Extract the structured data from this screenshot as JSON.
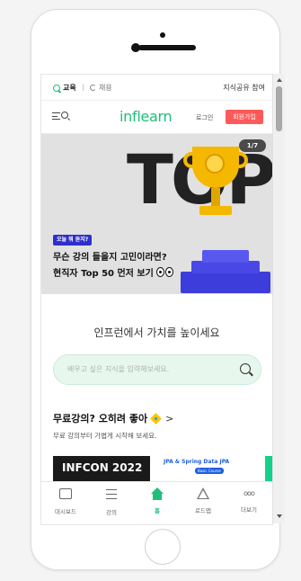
{
  "topbar": {
    "edu_label": "교육",
    "job_label": "채용",
    "share_label": "지식공유 참여"
  },
  "header": {
    "logo": "inflearn",
    "login_label": "로그인",
    "signup_label": "회원가입"
  },
  "banner": {
    "top_text": "TOP",
    "pager": "1/7",
    "badge": "오늘 뭐 듣지?",
    "title_line1": "무슨 강의 들을지 고민이라면?",
    "title_line2": "현직자 Top 50 먼저 보기"
  },
  "main": {
    "headline": "인프런에서 가치를 높이세요",
    "search_placeholder": "배우고 싶은 지식을 입력해보세요.",
    "section_title": "무료강의? 오히려 좋아",
    "section_arrow": ">",
    "section_sub": "무료 강의부터 가볍게 시작해 보세요."
  },
  "cards": [
    {
      "title": "INFCON 2022"
    },
    {
      "title": "JPA & Spring Data JPA",
      "tag": "Basic Course"
    }
  ],
  "bottom_nav": [
    {
      "label": "대시보드",
      "icon": "dashboard-icon"
    },
    {
      "label": "강의",
      "icon": "list-icon"
    },
    {
      "label": "홈",
      "icon": "home-icon",
      "active": true
    },
    {
      "label": "로드맵",
      "icon": "roadmap-icon"
    },
    {
      "label": "더보기",
      "icon": "more-icon"
    }
  ],
  "colors": {
    "brand": "#1dc078",
    "signup": "#ff5a5a",
    "badge": "#2f2fcc"
  }
}
